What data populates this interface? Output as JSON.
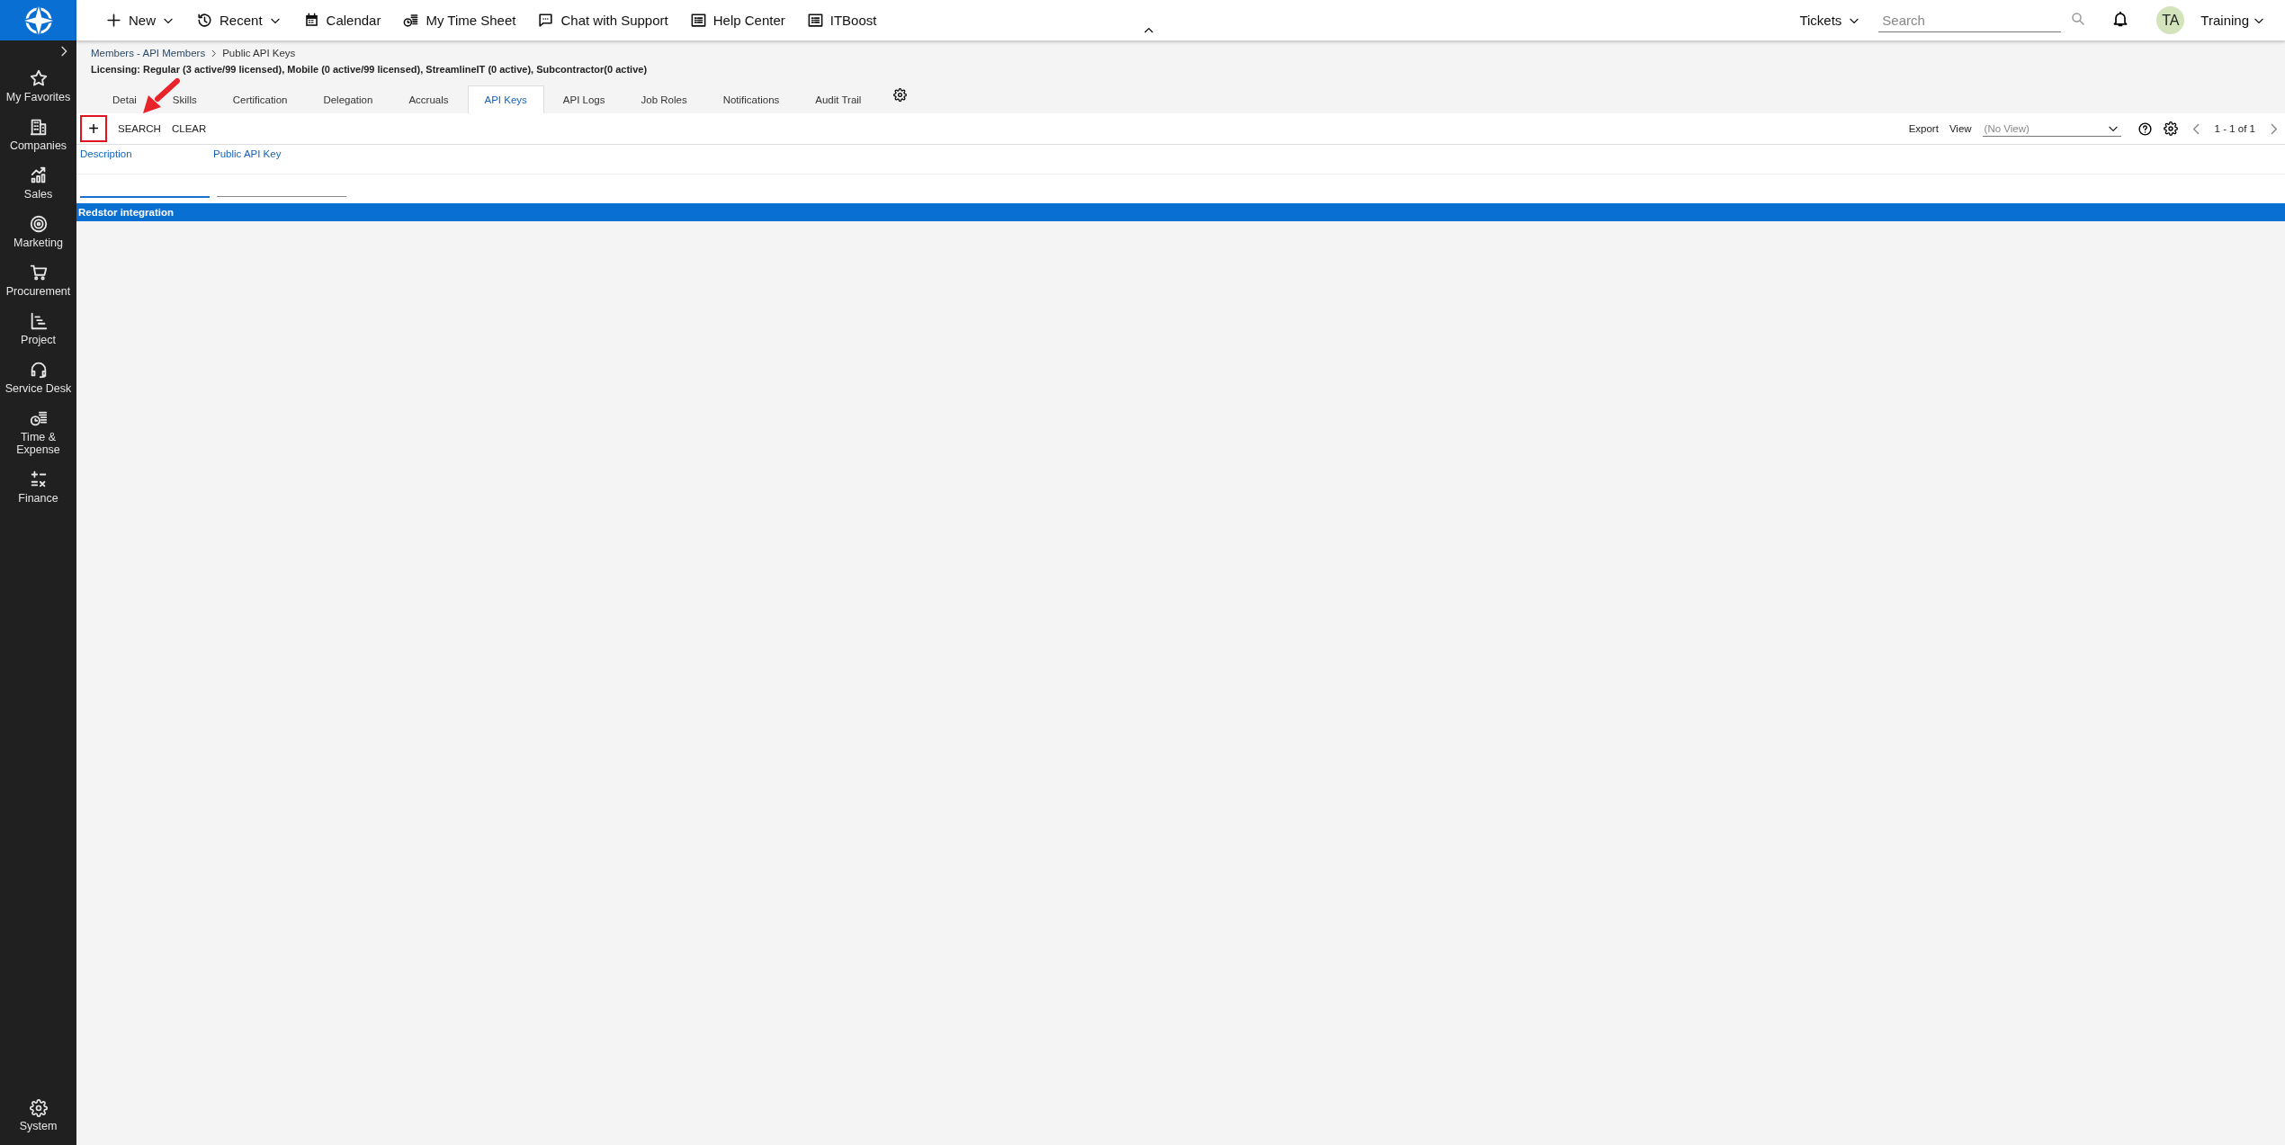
{
  "top_bar": {
    "menu": [
      {
        "label": "New",
        "dropdown": true
      },
      {
        "label": "Recent",
        "dropdown": true
      },
      {
        "label": "Calendar",
        "dropdown": false
      },
      {
        "label": "My Time Sheet",
        "dropdown": false
      },
      {
        "label": "Chat with Support",
        "dropdown": false
      },
      {
        "label": "Help Center",
        "dropdown": false
      },
      {
        "label": "ITBoost",
        "dropdown": false
      }
    ],
    "tickets": "Tickets",
    "search": {
      "placeholder": "Search"
    },
    "user": {
      "initials": "TA",
      "name": "Training"
    }
  },
  "sidebar": {
    "items": [
      {
        "label": "My Favorites"
      },
      {
        "label": "Companies"
      },
      {
        "label": "Sales"
      },
      {
        "label": "Marketing"
      },
      {
        "label": "Procurement"
      },
      {
        "label": "Project"
      },
      {
        "label": "Service Desk"
      },
      {
        "label": "Time & Expense"
      },
      {
        "label": "Finance"
      }
    ],
    "bottom": {
      "label": "System"
    }
  },
  "breadcrumb": [
    "Members - API Members",
    "Public API Keys"
  ],
  "licensing": "Licensing: Regular (3 active/99 licensed), Mobile (0 active/99 licensed), StreamlineIT (0 active), Subcontractor(0 active)",
  "tabs": [
    {
      "label": "Detai",
      "selected": false
    },
    {
      "label": "Skills",
      "selected": false
    },
    {
      "label": "Certification",
      "selected": false
    },
    {
      "label": "Delegation",
      "selected": false
    },
    {
      "label": "Accruals",
      "selected": false
    },
    {
      "label": "API Keys",
      "selected": true
    },
    {
      "label": "API Logs",
      "selected": false
    },
    {
      "label": "Job Roles",
      "selected": false
    },
    {
      "label": "Notifications",
      "selected": false
    },
    {
      "label": "Audit Trail",
      "selected": false
    }
  ],
  "toolbar": {
    "add": "+",
    "search": "SEARCH",
    "clear": "CLEAR",
    "export": "Export",
    "view_label": "View",
    "view": {
      "placeholder": "(No View)"
    },
    "pagination": "1 - 1 of 1"
  },
  "table": {
    "columns": [
      "Description",
      "Public API Key"
    ],
    "rows": [
      {
        "cells": [
          "Redstor integration"
        ],
        "selected": true
      }
    ]
  }
}
